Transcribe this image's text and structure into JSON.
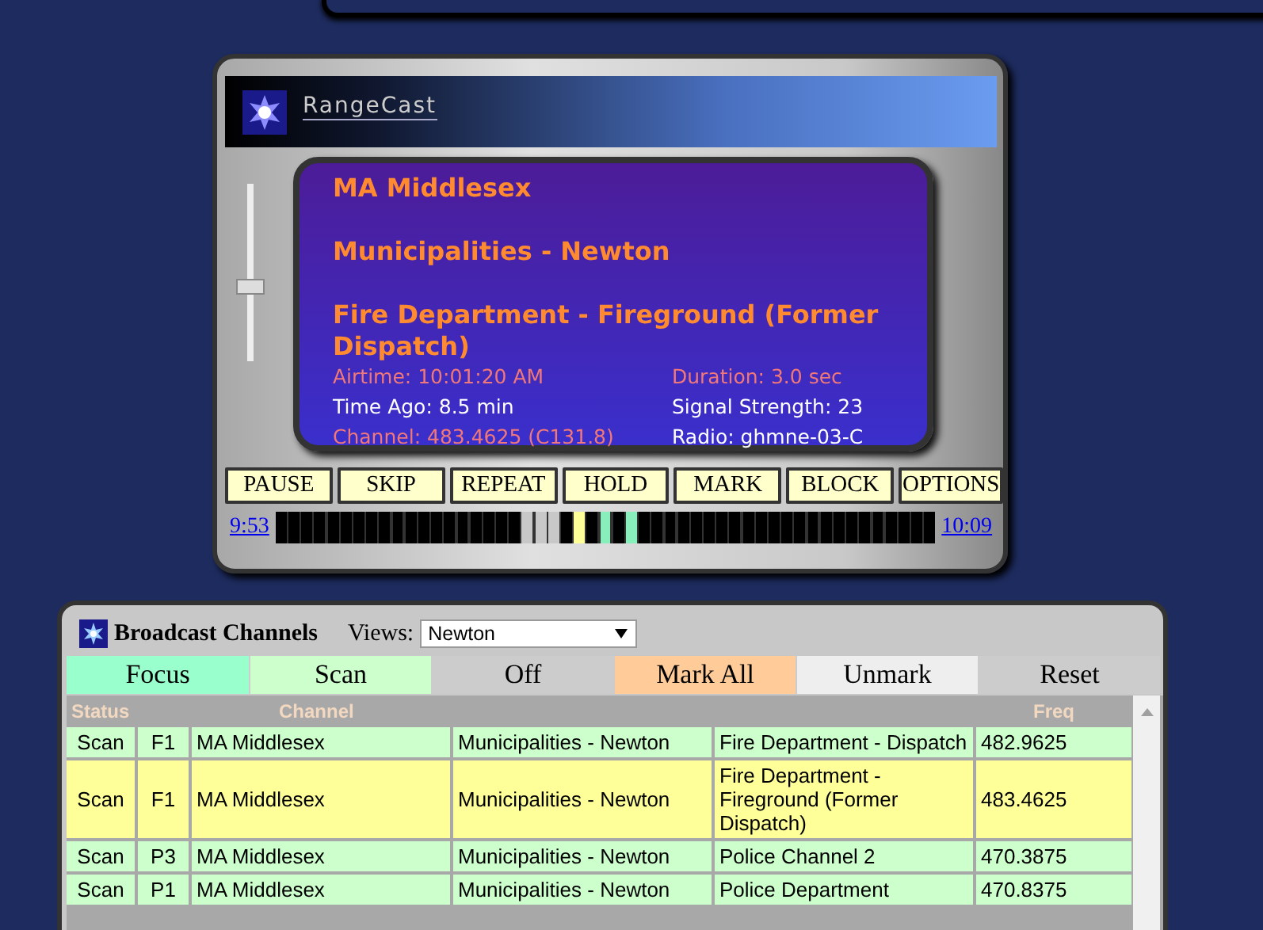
{
  "player": {
    "brand": "RangeCast",
    "lines": [
      "MA Middlesex",
      "Municipalities - Newton",
      "Fire Department - Fireground (Former Dispatch)"
    ],
    "details": [
      {
        "text": "Airtime: 10:01:20 AM",
        "kind": "accent"
      },
      {
        "text": "Duration: 3.0 sec",
        "kind": "accent"
      },
      {
        "text": "Time Ago: 8.5 min",
        "kind": "plain"
      },
      {
        "text": "Signal Strength: 23",
        "kind": "plain"
      },
      {
        "text": "Channel: 483.4625 (C131.8)",
        "kind": "accent"
      },
      {
        "text": "Radio: ghmne-03-C",
        "kind": "plain"
      }
    ],
    "volume": {
      "level": 0.42
    },
    "buttons": [
      "PAUSE",
      "SKIP",
      "REPEAT",
      "HOLD",
      "MARK",
      "BLOCK",
      "OPTIONS"
    ],
    "timeline": {
      "start": "9:53",
      "end": "10:09",
      "segments": [
        {
          "color": "#000000"
        },
        {
          "color": "#000000"
        },
        {
          "color": "#000000"
        },
        {
          "color": "#000000"
        },
        {
          "color": "#000000"
        },
        {
          "color": "#000000"
        },
        {
          "color": "#000000"
        },
        {
          "color": "#000000"
        },
        {
          "color": "#000000"
        },
        {
          "color": "#000000"
        },
        {
          "color": "#000000"
        },
        {
          "color": "#000000"
        },
        {
          "color": "#000000"
        },
        {
          "color": "#000000"
        },
        {
          "color": "#000000"
        },
        {
          "color": "#000000"
        },
        {
          "color": "#000000"
        },
        {
          "color": "#000000"
        },
        {
          "color": "#000000"
        },
        {
          "color": "#c8c8c8"
        },
        {
          "color": "#c8c8c8"
        },
        {
          "color": "#c8c8c8"
        },
        {
          "color": "#000000"
        },
        {
          "color": "#ffff99"
        },
        {
          "color": "#000000"
        },
        {
          "color": "#88eebb"
        },
        {
          "color": "#000000"
        },
        {
          "color": "#88eebb"
        },
        {
          "color": "#000000"
        },
        {
          "color": "#000000"
        },
        {
          "color": "#000000"
        },
        {
          "color": "#000000"
        },
        {
          "color": "#000000"
        },
        {
          "color": "#000000"
        },
        {
          "color": "#000000"
        },
        {
          "color": "#000000"
        },
        {
          "color": "#000000"
        },
        {
          "color": "#000000"
        },
        {
          "color": "#000000"
        },
        {
          "color": "#000000"
        },
        {
          "color": "#000000"
        },
        {
          "color": "#000000"
        },
        {
          "color": "#000000"
        },
        {
          "color": "#000000"
        },
        {
          "color": "#000000"
        },
        {
          "color": "#000000"
        },
        {
          "color": "#000000"
        },
        {
          "color": "#000000"
        },
        {
          "color": "#000000"
        },
        {
          "color": "#000000"
        },
        {
          "color": "#000000"
        }
      ]
    }
  },
  "channels": {
    "title": "Broadcast Channels",
    "views_label": "Views:",
    "view": "Newton",
    "filters": [
      {
        "label": "Focus",
        "color": "#99ffcc"
      },
      {
        "label": "Scan",
        "color": "#ccffcc"
      },
      {
        "label": "Off",
        "color": "#cccccc"
      },
      {
        "label": "Mark All",
        "color": "#ffcc99"
      },
      {
        "label": "Unmark",
        "color": "#eeeeee"
      },
      {
        "label": "Reset",
        "color": "#cccccc"
      }
    ],
    "columns": [
      "Status",
      "",
      "Channel",
      "",
      "",
      "Freq"
    ],
    "rows": [
      {
        "selected": false,
        "cells": [
          "Scan",
          "F1",
          "MA Middlesex",
          "Municipalities - Newton",
          "Fire Department - Dispatch",
          "482.9625"
        ]
      },
      {
        "selected": true,
        "cells": [
          "Scan",
          "F1",
          "MA Middlesex",
          "Municipalities - Newton",
          "Fire Department - Fireground (Former Dispatch)",
          "483.4625"
        ]
      },
      {
        "selected": false,
        "cells": [
          "Scan",
          "P3",
          "MA Middlesex",
          "Municipalities - Newton",
          "Police Channel 2",
          "470.3875"
        ]
      },
      {
        "selected": false,
        "cells": [
          "Scan",
          "P1",
          "MA Middlesex",
          "Municipalities - Newton",
          "Police Department",
          "470.8375"
        ]
      }
    ]
  }
}
